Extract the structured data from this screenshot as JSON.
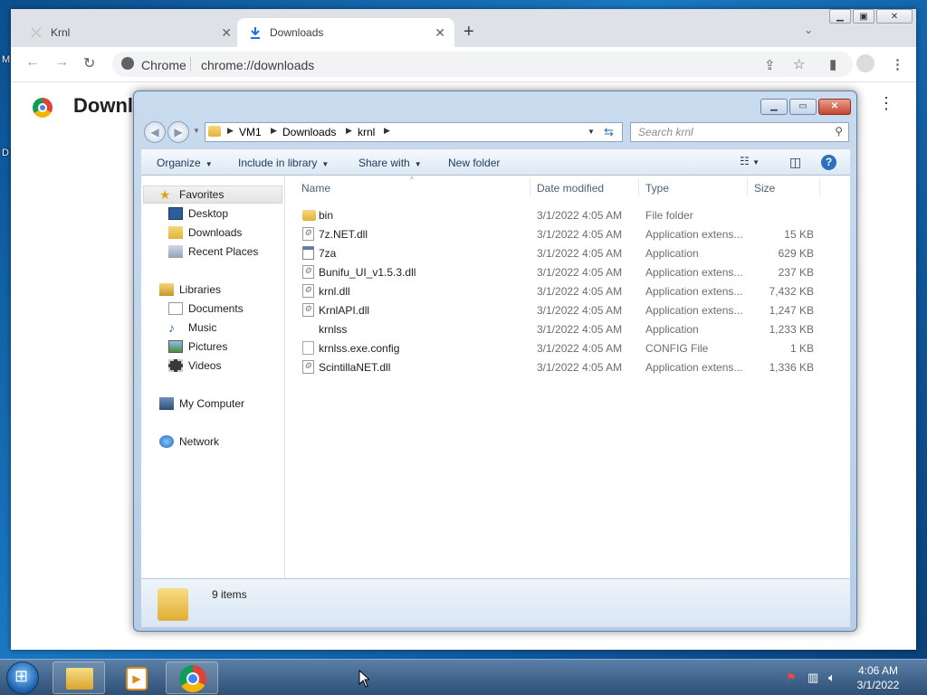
{
  "desktop": {
    "left_labels": [
      "M",
      "D"
    ]
  },
  "chrome": {
    "tabs": [
      {
        "label": "Krnl",
        "icon": "krnl-favicon-icon",
        "close": "✕"
      },
      {
        "label": "Downloads",
        "icon": "download-icon",
        "close": "✕"
      }
    ],
    "new_tab": "+",
    "tab_search": "⌄",
    "omnibox": {
      "site": "Chrome",
      "url": "chrome://downloads"
    },
    "page_title": "Downloads",
    "menu": "⋮",
    "toolbar_icons": [
      "share-icon",
      "star-icon",
      "side-panel-icon",
      "profile-icon",
      "menu-icon"
    ]
  },
  "explorer": {
    "breadcrumbs": [
      "VM1",
      "Downloads",
      "krnl"
    ],
    "search_placeholder": "Search krnl",
    "commands": [
      "Organize",
      "Include in library",
      "Share with",
      "New folder"
    ],
    "nav": {
      "favorites": {
        "label": "Favorites",
        "items": [
          "Desktop",
          "Downloads",
          "Recent Places"
        ]
      },
      "libraries": {
        "label": "Libraries",
        "items": [
          "Documents",
          "Music",
          "Pictures",
          "Videos"
        ]
      },
      "computer": "My Computer",
      "network": "Network"
    },
    "columns": [
      "Name",
      "Date modified",
      "Type",
      "Size"
    ],
    "files": [
      {
        "name": "bin",
        "date": "3/1/2022 4:05 AM",
        "type": "File folder",
        "size": "",
        "icon": "folder"
      },
      {
        "name": "7z.NET.dll",
        "date": "3/1/2022 4:05 AM",
        "type": "Application extens...",
        "size": "15 KB",
        "icon": "dll"
      },
      {
        "name": "7za",
        "date": "3/1/2022 4:05 AM",
        "type": "Application",
        "size": "629 KB",
        "icon": "app"
      },
      {
        "name": "Bunifu_UI_v1.5.3.dll",
        "date": "3/1/2022 4:05 AM",
        "type": "Application extens...",
        "size": "237 KB",
        "icon": "dll"
      },
      {
        "name": "krnl.dll",
        "date": "3/1/2022 4:05 AM",
        "type": "Application extens...",
        "size": "7,432 KB",
        "icon": "dll"
      },
      {
        "name": "KrnlAPI.dll",
        "date": "3/1/2022 4:05 AM",
        "type": "Application extens...",
        "size": "1,247 KB",
        "icon": "dll"
      },
      {
        "name": "krnlss",
        "date": "3/1/2022 4:05 AM",
        "type": "Application",
        "size": "1,233 KB",
        "icon": "app"
      },
      {
        "name": "krnlss.exe.config",
        "date": "3/1/2022 4:05 AM",
        "type": "CONFIG File",
        "size": "1 KB",
        "icon": "config"
      },
      {
        "name": "ScintillaNET.dll",
        "date": "3/1/2022 4:05 AM",
        "type": "Application extens...",
        "size": "1,336 KB",
        "icon": "dll"
      }
    ],
    "status": "9 items"
  },
  "taskbar": {
    "clock_time": "4:06 AM",
    "clock_date": "3/1/2022"
  }
}
